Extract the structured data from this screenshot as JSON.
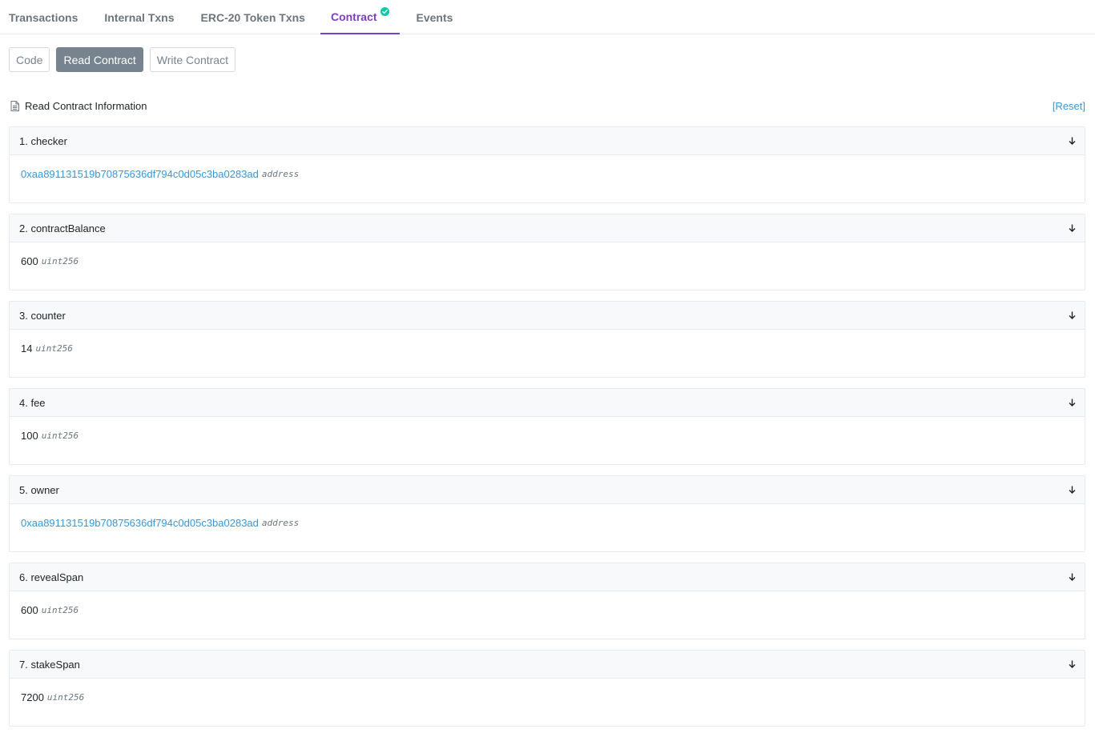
{
  "tabs": [
    {
      "label": "Transactions"
    },
    {
      "label": "Internal Txns"
    },
    {
      "label": "ERC-20 Token Txns"
    },
    {
      "label": "Contract",
      "active": true,
      "icon": "verified-check-icon"
    },
    {
      "label": "Events"
    }
  ],
  "sub_buttons": [
    {
      "label": "Code"
    },
    {
      "label": "Read Contract",
      "active": true
    },
    {
      "label": "Write Contract"
    }
  ],
  "info": {
    "title": "Read Contract Information",
    "reset_label": "[Reset]",
    "icon": "document-icon"
  },
  "methods": [
    {
      "header": "1. checker",
      "value": "0xaa891131519b70875636df794c0d05c3ba0283ad",
      "type": "address",
      "is_link": true
    },
    {
      "header": "2. contractBalance",
      "value": "600",
      "type": "uint256",
      "is_link": false
    },
    {
      "header": "3. counter",
      "value": "14",
      "type": "uint256",
      "is_link": false
    },
    {
      "header": "4. fee",
      "value": "100",
      "type": "uint256",
      "is_link": false
    },
    {
      "header": "5. owner",
      "value": "0xaa891131519b70875636df794c0d05c3ba0283ad",
      "type": "address",
      "is_link": true
    },
    {
      "header": "6. revealSpan",
      "value": "600",
      "type": "uint256",
      "is_link": false
    },
    {
      "header": "7. stakeSpan",
      "value": "7200",
      "type": "uint256",
      "is_link": false
    }
  ],
  "colors": {
    "accent": "#7b3fc1",
    "link": "#3498db",
    "verified": "#00c9a7",
    "muted": "#77838f"
  }
}
